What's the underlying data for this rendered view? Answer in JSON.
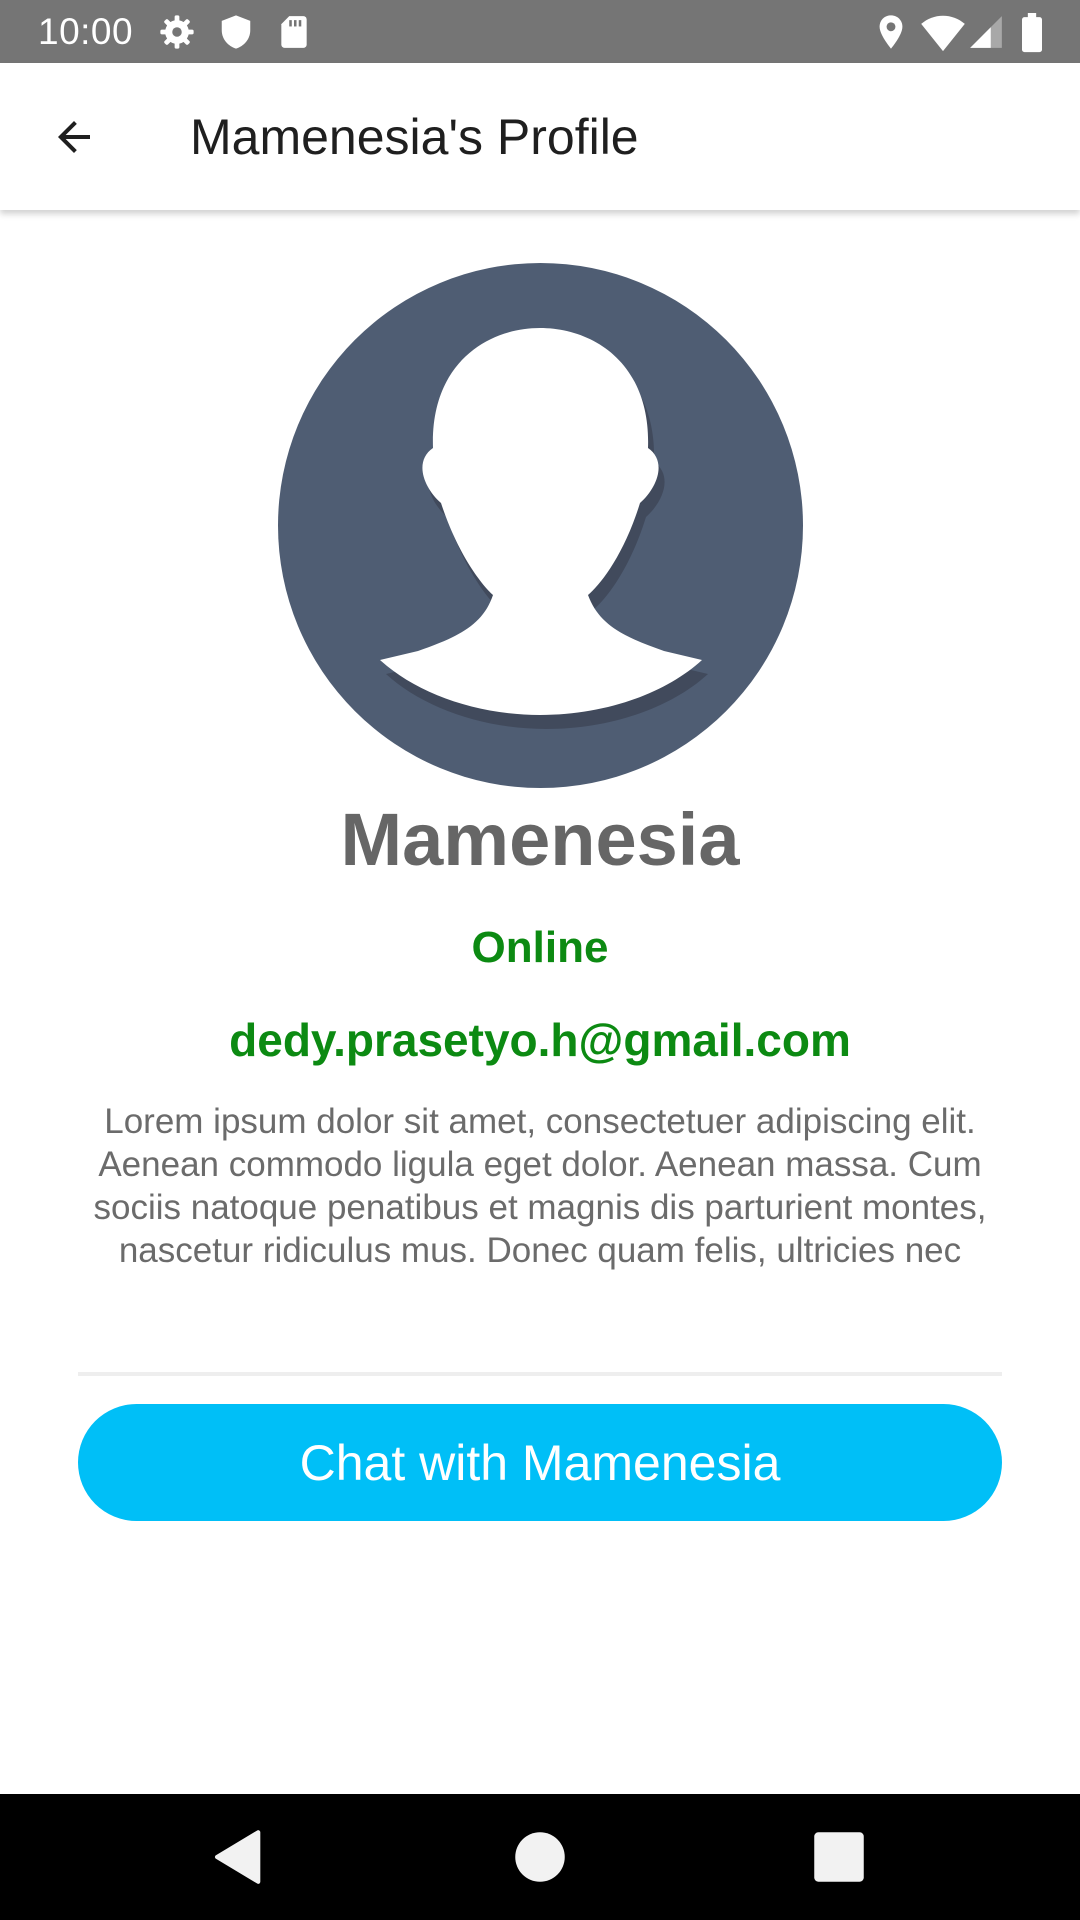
{
  "status_bar": {
    "time": "10:00",
    "background": "#757575",
    "left_icons": [
      "settings-icon",
      "shield-icon",
      "sd-card-icon"
    ],
    "right_icons": [
      "location-icon",
      "wifi-icon",
      "signal-icon",
      "battery-icon"
    ]
  },
  "app_bar": {
    "back_icon": "arrow-back-icon",
    "title": "Mamenesia's Profile"
  },
  "profile": {
    "avatar_icon": "person-silhouette-icon",
    "avatar_color": "#4f5d73",
    "name": "Mamenesia",
    "status": "Online",
    "status_color": "#0c8a12",
    "email": "dedy.prasetyo.h@gmail.com",
    "bio": "Lorem ipsum dolor sit amet, consectetuer adipiscing elit. Aenean commodo ligula eget dolor. Aenean massa. Cum sociis natoque penatibus et magnis dis parturient montes, nascetur ridiculus mus. Donec quam felis, ultricies nec"
  },
  "chat_button": {
    "label": "Chat with Mamenesia",
    "color": "#00bff7"
  },
  "nav_bar": {
    "icons": [
      "nav-back-icon",
      "nav-home-icon",
      "nav-recents-icon"
    ]
  }
}
